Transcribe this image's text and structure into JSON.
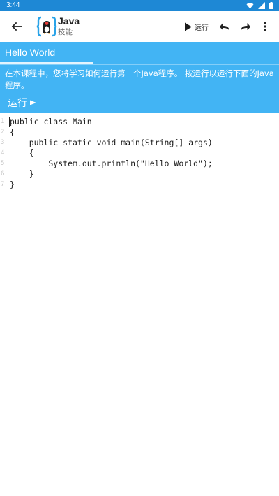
{
  "status_bar": {
    "time": "3:44"
  },
  "app_bar": {
    "title": "Java",
    "subtitle": "技能",
    "run_label": "运行"
  },
  "lesson": {
    "tab_label": "Hello World",
    "description": "在本课程中，您将学习如何运行第一个Java程序。 按运行以运行下面的Java程序。",
    "run_link_label": "运行"
  },
  "editor": {
    "line_numbers": [
      "1",
      "2",
      "3",
      "4",
      "5",
      "6",
      "7"
    ],
    "lines": [
      "public class Main",
      "{",
      "    public static void main(String[] args)",
      "    {",
      "        System.out.println(\"Hello World\");",
      "    }",
      "}"
    ]
  },
  "colors": {
    "status_bar": "#1e88d5",
    "lesson_panel": "#42b4f4",
    "app_bar": "#ffffff"
  },
  "icons": [
    "back-arrow-icon",
    "app-logo-icon",
    "play-icon",
    "undo-icon",
    "redo-icon",
    "more-vert-icon",
    "wifi-icon",
    "signal-icon",
    "battery-icon",
    "triangle-right-icon"
  ]
}
